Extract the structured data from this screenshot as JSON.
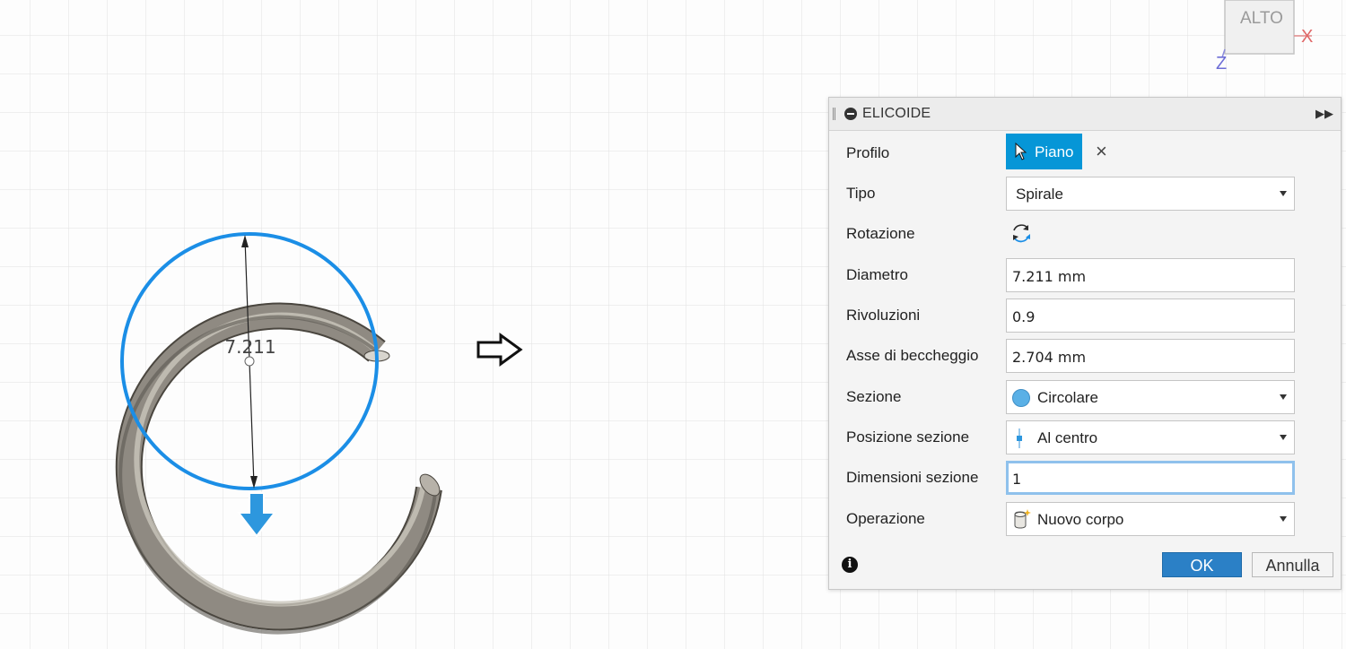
{
  "viewcube": {
    "face_label": "ALTO",
    "axis_x": "X",
    "axis_z": "Z"
  },
  "canvas": {
    "dimension_value": "7.211"
  },
  "dialog": {
    "title": "ELICOIDE",
    "rows": {
      "profilo": {
        "label": "Profilo",
        "selection": "Piano",
        "clear_icon": "×"
      },
      "tipo": {
        "label": "Tipo",
        "value": "Spirale"
      },
      "rotazione": {
        "label": "Rotazione"
      },
      "diametro": {
        "label": "Diametro",
        "value": "7.211 mm"
      },
      "rivoluzioni": {
        "label": "Rivoluzioni",
        "value": "0.9"
      },
      "asse": {
        "label": "Asse di beccheggio",
        "value": "2.704 mm"
      },
      "sezione": {
        "label": "Sezione",
        "value": "Circolare"
      },
      "posizione": {
        "label": "Posizione sezione",
        "value": "Al centro"
      },
      "dimensioni": {
        "label": "Dimensioni sezione",
        "value": "1"
      },
      "operazione": {
        "label": "Operazione",
        "value": "Nuovo corpo"
      }
    },
    "ok_label": "OK",
    "cancel_label": "Annulla",
    "info_icon": "i"
  },
  "colors": {
    "accent": "#0696d7",
    "sketch_blue": "#1b8ee6",
    "body_gray": "#8f8a82"
  }
}
